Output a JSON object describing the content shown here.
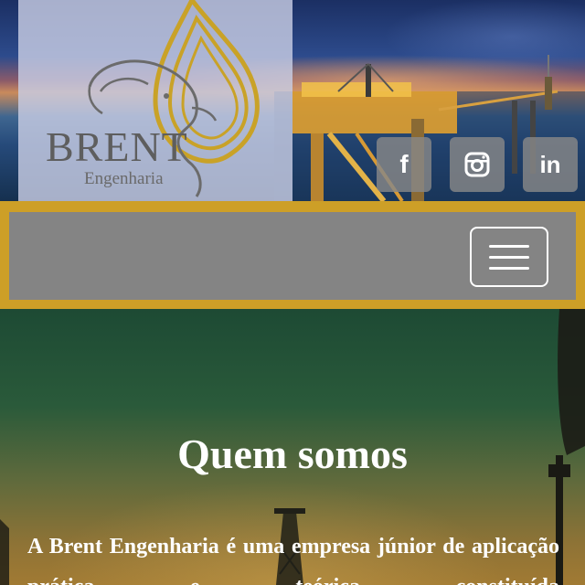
{
  "header": {
    "brand_name": "BRENT",
    "brand_subtitle": "Engenharia",
    "social": [
      {
        "name": "facebook",
        "glyph": "f",
        "icon": "facebook-icon"
      },
      {
        "name": "instagram",
        "glyph": "",
        "icon": "instagram-icon"
      },
      {
        "name": "linkedin",
        "glyph": "in",
        "icon": "linkedin-icon"
      }
    ]
  },
  "nav": {
    "menu_icon": "hamburger-menu-icon"
  },
  "hero": {
    "title": "Quem somos",
    "text": "A Brent Engenharia é uma empresa júnior de aplicação prática e teórica constituída"
  },
  "colors": {
    "gold": "#cd9f27",
    "nav_gray": "#848484",
    "logo_panel": "#c8cde4",
    "social_button": "#878787",
    "text_white": "#ffffff"
  }
}
